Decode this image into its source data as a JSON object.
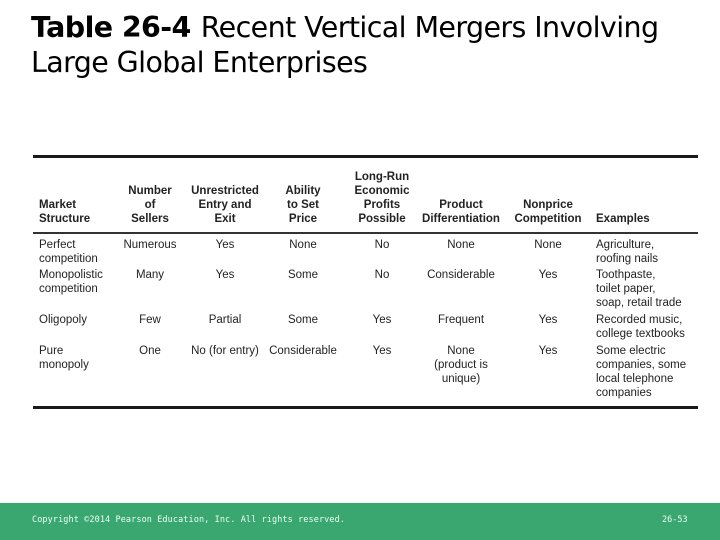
{
  "title": {
    "number": "Table 26-4",
    "text_line1": "Recent Vertical Mergers Involving",
    "text_line2": "Large Global Enterprises"
  },
  "table": {
    "headers": [
      [
        "Market",
        "Structure"
      ],
      [
        "Number",
        "of",
        "Sellers"
      ],
      [
        "Unrestricted",
        "Entry and",
        "Exit"
      ],
      [
        "Ability",
        "to Set",
        "Price"
      ],
      [
        "Long-Run",
        "Economic",
        "Profits",
        "Possible"
      ],
      [
        "Product",
        "Differentiation"
      ],
      [
        "Nonprice",
        "Competition"
      ],
      [
        "Examples"
      ]
    ],
    "rows": [
      {
        "market_structure": [
          "Perfect",
          "competition"
        ],
        "number_of_sellers": "Numerous",
        "unrestricted_entry_exit": "Yes",
        "ability_to_set_price": "None",
        "long_run_profits": "No",
        "product_differentiation": [
          "None"
        ],
        "nonprice_competition": "None",
        "examples": [
          "Agriculture,",
          "roofing nails"
        ]
      },
      {
        "market_structure": [
          "Monopolistic",
          "competition"
        ],
        "number_of_sellers": "Many",
        "unrestricted_entry_exit": "Yes",
        "ability_to_set_price": "Some",
        "long_run_profits": "No",
        "product_differentiation": [
          "Considerable"
        ],
        "nonprice_competition": "Yes",
        "examples": [
          "Toothpaste,",
          "toilet paper,",
          "soap, retail trade"
        ]
      },
      {
        "market_structure": [
          "Oligopoly"
        ],
        "number_of_sellers": "Few",
        "unrestricted_entry_exit": "Partial",
        "ability_to_set_price": "Some",
        "long_run_profits": "Yes",
        "product_differentiation": [
          "Frequent"
        ],
        "nonprice_competition": "Yes",
        "examples": [
          "Recorded music,",
          "college textbooks"
        ]
      },
      {
        "market_structure": [
          "Pure",
          "monopoly"
        ],
        "number_of_sellers": "One",
        "unrestricted_entry_exit": "No (for entry)",
        "ability_to_set_price": "Considerable",
        "long_run_profits": "Yes",
        "product_differentiation": [
          "None",
          "(product is",
          "unique)"
        ],
        "nonprice_competition": "Yes",
        "examples": [
          "Some electric",
          "companies, some",
          "local telephone",
          "companies"
        ]
      }
    ]
  },
  "footer": {
    "copyright": "Copyright ©2014 Pearson Education, Inc. All rights reserved.",
    "page_number": "26-53",
    "color": "#3aa771"
  }
}
